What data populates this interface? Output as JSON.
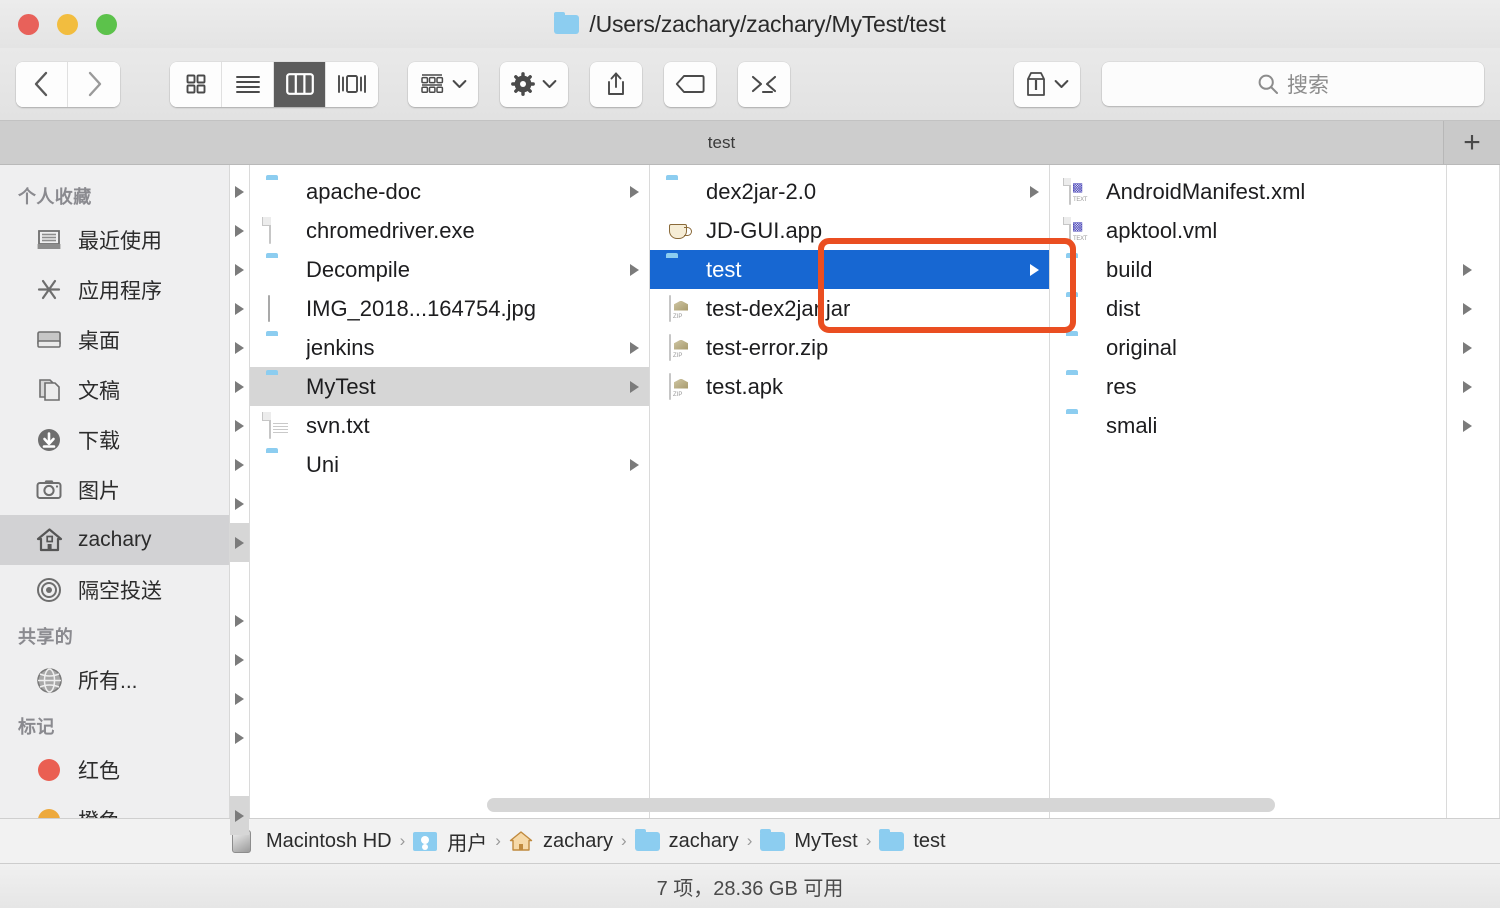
{
  "window": {
    "title": "/Users/zachary/zachary/MyTest/test",
    "title_icon": "folder-icon",
    "traffic_lights": {
      "close": "close-button",
      "minimize": "minimize-button",
      "maximize": "maximize-button",
      "close_color": "#e8615a",
      "minimize_color": "#f2bd3f",
      "maximize_color": "#5cc24b"
    }
  },
  "toolbar": {
    "back_label": "‹",
    "forward_label": "›",
    "view_modes": [
      {
        "name": "icon-view",
        "icon": "grid-icon",
        "active": false
      },
      {
        "name": "list-view",
        "icon": "list-icon",
        "active": false
      },
      {
        "name": "column-view",
        "icon": "columns-icon",
        "active": true
      },
      {
        "name": "gallery-view",
        "icon": "gallery-icon",
        "active": false
      }
    ],
    "group_button": {
      "name": "group-by-button",
      "icon": "group-icon",
      "chevron": "⌄"
    },
    "action_button": {
      "name": "action-button",
      "icon": "gear-icon",
      "chevron": "⌄"
    },
    "share_button": {
      "name": "share-button",
      "icon": "share-icon"
    },
    "tag_button": {
      "name": "tag-button",
      "icon": "tag-icon"
    },
    "terminal_button": {
      "name": "terminal-button",
      "icon": "terminal-icon",
      "label": ">_<"
    },
    "archive_button": {
      "name": "archive-button",
      "icon": "archive-icon",
      "chevron": "⌄"
    },
    "search": {
      "placeholder": "搜索",
      "value": "",
      "icon": "search-icon"
    }
  },
  "tabbar": {
    "tabs": [
      {
        "label": "test",
        "active": true
      }
    ],
    "add_label": "+"
  },
  "sidebar": {
    "sections": [
      {
        "header": "个人收藏",
        "items": [
          {
            "label": "最近使用",
            "icon": "recents-icon",
            "selected": false
          },
          {
            "label": "应用程序",
            "icon": "applications-icon",
            "selected": false
          },
          {
            "label": "桌面",
            "icon": "desktop-icon",
            "selected": false
          },
          {
            "label": "文稿",
            "icon": "documents-icon",
            "selected": false
          },
          {
            "label": "下载",
            "icon": "downloads-icon",
            "selected": false
          },
          {
            "label": "图片",
            "icon": "pictures-icon",
            "selected": false
          },
          {
            "label": "zachary",
            "icon": "home-icon",
            "selected": true
          },
          {
            "label": "隔空投送",
            "icon": "airdrop-icon",
            "selected": false
          }
        ]
      },
      {
        "header": "共享的",
        "items": [
          {
            "label": "所有...",
            "icon": "network-globe-icon",
            "selected": false
          }
        ]
      },
      {
        "header": "标记",
        "items": [
          {
            "label": "红色",
            "icon": "tag-dot-icon",
            "color": "#ea5f52",
            "selected": false
          },
          {
            "label": "橙色",
            "icon": "tag-dot-icon",
            "color": "#eda93c",
            "selected": false
          }
        ]
      }
    ]
  },
  "columns": [
    {
      "name": "column-1",
      "rows": [
        {
          "label": "apache-doc",
          "icon": "folder-icon",
          "disclosure": true,
          "selected": false
        },
        {
          "label": "chromedriver.exe",
          "icon": "blank-doc-icon",
          "disclosure": false,
          "selected": false
        },
        {
          "label": "Decompile",
          "icon": "folder-icon",
          "disclosure": true,
          "selected": false
        },
        {
          "label": "IMG_2018...164754.jpg",
          "icon": "image-icon",
          "disclosure": false,
          "selected": false
        },
        {
          "label": "jenkins",
          "icon": "folder-icon",
          "disclosure": true,
          "selected": false
        },
        {
          "label": "MyTest",
          "icon": "folder-icon",
          "disclosure": true,
          "selected": true,
          "selection": "gray"
        },
        {
          "label": "svn.txt",
          "icon": "text-doc-icon",
          "disclosure": false,
          "selected": false
        },
        {
          "label": "Uni",
          "icon": "folder-icon",
          "disclosure": true,
          "selected": false
        }
      ]
    },
    {
      "name": "column-2",
      "rows": [
        {
          "label": "dex2jar-2.0",
          "icon": "folder-icon",
          "disclosure": true,
          "selected": false
        },
        {
          "label": "JD-GUI.app",
          "icon": "java-app-icon",
          "disclosure": false,
          "selected": false
        },
        {
          "label": "test",
          "icon": "folder-icon",
          "disclosure": true,
          "selected": true,
          "selection": "blue"
        },
        {
          "label": "test-dex2jar.jar",
          "icon": "zip-icon",
          "disclosure": false,
          "selected": false
        },
        {
          "label": "test-error.zip",
          "icon": "zip-icon",
          "disclosure": false,
          "selected": false
        },
        {
          "label": "test.apk",
          "icon": "zip-icon",
          "disclosure": false,
          "selected": false
        }
      ]
    },
    {
      "name": "column-3",
      "rows": [
        {
          "label": "AndroidManifest.xml",
          "icon": "xml-doc-icon",
          "disclosure": false,
          "selected": false
        },
        {
          "label": "apktool.vml",
          "icon": "xml-doc-icon",
          "disclosure": false,
          "selected": false
        },
        {
          "label": "build",
          "icon": "folder-icon",
          "disclosure": true,
          "selected": false,
          "highlighted": true
        },
        {
          "label": "dist",
          "icon": "folder-icon",
          "disclosure": true,
          "selected": false,
          "highlighted": true
        },
        {
          "label": "original",
          "icon": "folder-icon",
          "disclosure": true,
          "selected": false
        },
        {
          "label": "res",
          "icon": "folder-icon",
          "disclosure": true,
          "selected": false
        },
        {
          "label": "smali",
          "icon": "folder-icon",
          "disclosure": true,
          "selected": false
        }
      ]
    }
  ],
  "annotation": {
    "type": "red-rectangle-highlight",
    "color": "#ea4e21",
    "covers": [
      "build",
      "dist"
    ]
  },
  "pathbar": {
    "crumbs": [
      {
        "label": "Macintosh HD",
        "icon": "hard-drive-icon"
      },
      {
        "label": "用户",
        "icon": "users-folder-icon"
      },
      {
        "label": "zachary",
        "icon": "home-icon"
      },
      {
        "label": "zachary",
        "icon": "folder-icon"
      },
      {
        "label": "MyTest",
        "icon": "folder-icon"
      },
      {
        "label": "test",
        "icon": "folder-icon"
      }
    ],
    "separator": "›"
  },
  "statusbar": {
    "text": "7 项，28.36 GB 可用"
  }
}
